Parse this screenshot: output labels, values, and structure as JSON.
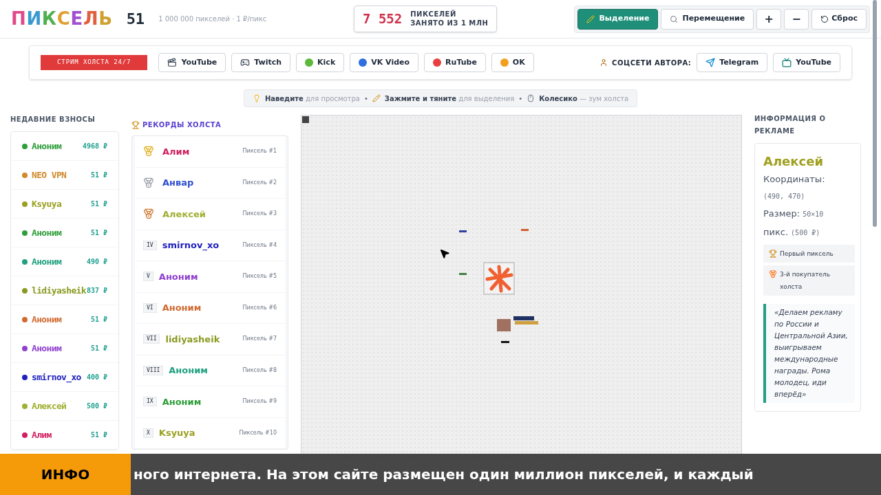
{
  "header": {
    "logo": "ПИКСЕЛЬ",
    "count": "51",
    "subtitle": "1 000 000 пикселей · 1 ₽/пикс",
    "counter": {
      "value": "7 552",
      "line_1": "ПИКСЕЛЕЙ",
      "line_2": "ЗАНЯТО ИЗ 1 МЛН"
    },
    "modes": [
      {
        "kind": "select",
        "label": "Выделение",
        "selected": true
      },
      {
        "kind": "move",
        "label": "Перемещение",
        "selected": false
      }
    ],
    "zoom_in": "+",
    "zoom_out": "−",
    "reset": "Сброс"
  },
  "social": {
    "stream_badge": "СТРИМ ХОЛСТА 24/7",
    "streams": [
      {
        "kind": "video",
        "label": "YouTube"
      },
      {
        "kind": "game",
        "label": "Twitch"
      },
      {
        "kind": "dot",
        "label": "Kick",
        "color": "#5cb83a"
      },
      {
        "kind": "dot",
        "label": "VK Video",
        "color": "#2f6fe0"
      },
      {
        "kind": "dot",
        "label": "RuTube",
        "color": "#e84040"
      },
      {
        "kind": "dot",
        "label": "OK",
        "color": "#f0a020"
      }
    ],
    "author_label": "СОЦСЕТИ АВТОРА:",
    "author_links": [
      {
        "kind": "plane",
        "label": "Telegram"
      },
      {
        "kind": "tv",
        "label": "YouTube"
      }
    ]
  },
  "hints": {
    "separator": "•",
    "items": [
      {
        "kind": "hover",
        "text": "**Наведите** для просмотра"
      },
      {
        "kind": "drag",
        "text": "**Зажмите и тяните** для выделения"
      },
      {
        "kind": "wheel",
        "text": "**Колесико** — зум холста"
      }
    ]
  },
  "recent": {
    "title": "НЕДАВНИЕ ВЗНОСЫ",
    "items": [
      {
        "name": "Аноним",
        "amount": "4968 ₽",
        "color": "#2e9e3a"
      },
      {
        "name": "NEO VPN",
        "amount": "51 ₽",
        "color": "#d08a2a"
      },
      {
        "name": "Ksyuya",
        "amount": "51 ₽",
        "color": "#9aa020"
      },
      {
        "name": "Аноним",
        "amount": "51 ₽",
        "color": "#2e9e3a"
      },
      {
        "name": "Аноним",
        "amount": "490 ₽",
        "color": "#20a080"
      },
      {
        "name": "lidiyasheik",
        "amount": "837 ₽",
        "color": "#8a9a20"
      },
      {
        "name": "Аноним",
        "amount": "51 ₽",
        "color": "#d06a30"
      },
      {
        "name": "Аноним",
        "amount": "51 ₽",
        "color": "#9040d0"
      },
      {
        "name": "smirnov_xo",
        "amount": "400 ₽",
        "color": "#2020c0"
      },
      {
        "name": "Алексей",
        "amount": "500 ₽",
        "color": "#a0b030"
      },
      {
        "name": "Алим",
        "amount": "51 ₽",
        "color": "#d02060"
      }
    ]
  },
  "records": {
    "title": "РЕКОРДЫ ХОЛСТА",
    "items": [
      {
        "kind": "gold",
        "name": "Алим",
        "pixel": "Пиксель #1",
        "color": "#d02060"
      },
      {
        "kind": "silver",
        "name": "Анвар",
        "pixel": "Пиксель #2",
        "color": "#2f4fd0"
      },
      {
        "kind": "bronze",
        "name": "Алексей",
        "pixel": "Пиксель #3",
        "color": "#a0b030"
      },
      {
        "kind": "rank",
        "rank": "IV",
        "name": "smirnov_xo",
        "pixel": "Пиксель #4",
        "color": "#2020c0"
      },
      {
        "kind": "rank",
        "rank": "V",
        "name": "Аноним",
        "pixel": "Пиксель #5",
        "color": "#9040d0"
      },
      {
        "kind": "rank",
        "rank": "VI",
        "name": "Аноним",
        "pixel": "Пиксель #6",
        "color": "#d06a30"
      },
      {
        "kind": "rank",
        "rank": "VII",
        "name": "lidiyasheik",
        "pixel": "Пиксель #7",
        "color": "#8a9a20"
      },
      {
        "kind": "rank",
        "rank": "VIII",
        "name": "Аноним",
        "pixel": "Пиксель #8",
        "color": "#20a080"
      },
      {
        "kind": "rank",
        "rank": "IX",
        "name": "Аноним",
        "pixel": "Пиксель #9",
        "color": "#2e9e3a"
      },
      {
        "kind": "rank",
        "rank": "X",
        "name": "Ksyuya",
        "pixel": "Пиксель #10",
        "color": "#9aa020"
      }
    ]
  },
  "ad_info": {
    "title": "ИНФОРМАЦИЯ О РЕКЛАМЕ",
    "name": "Алексей",
    "coords_label": "Координаты:",
    "coords": "(490, 470)",
    "size_label": "Размер:",
    "size": "50×10",
    "size_unit": "пикс.",
    "price": "(500 ₽)",
    "badges": [
      {
        "kind": "trophy",
        "text": "Первый пиксель"
      },
      {
        "kind": "medal",
        "text": "3-й покупатель холста"
      }
    ],
    "quote": "«Делаем рекламу по России и Центральной Азии, выигрываем международные награды. Рома молодец, иди вперёд»"
  },
  "ticker": {
    "label": "ИНФО",
    "text": "ного интернета. На этом сайте размещен один миллион пикселей, и каждый"
  }
}
